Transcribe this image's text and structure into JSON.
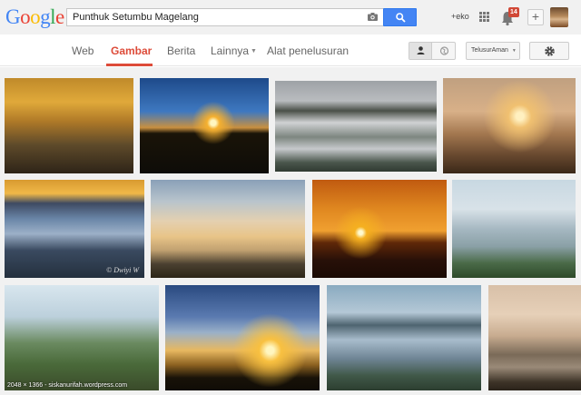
{
  "search": {
    "query": "Punthuk Setumbu Magelang"
  },
  "header": {
    "user_label": "+eko",
    "notification_count": "14"
  },
  "nav": {
    "tabs": [
      {
        "label": "Web"
      },
      {
        "label": "Gambar"
      },
      {
        "label": "Berita"
      },
      {
        "label": "Lainnya"
      },
      {
        "label": "Alat penelusuran"
      }
    ],
    "safesearch_label": "TelusurAman"
  },
  "results": {
    "hover_caption": "2048 × 1366 - siskanurifah.wordpress.com",
    "watermark": "© Dwiyi W"
  },
  "colors": {
    "accent": "#dd4b39",
    "search_button": "#4485f4",
    "badge": "#d14836"
  }
}
